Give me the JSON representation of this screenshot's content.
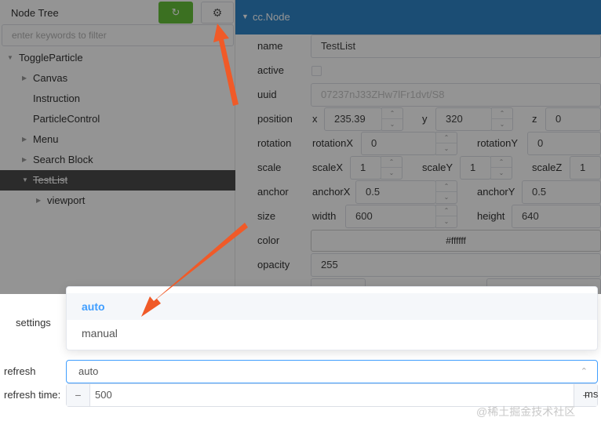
{
  "tree": {
    "title": "Node Tree",
    "refresh_icon": "refresh-icon",
    "settings_icon": "gear-icon",
    "filter_placeholder": "enter keywords to filter",
    "items": [
      {
        "label": "ToggleParticle"
      },
      {
        "label": "Canvas"
      },
      {
        "label": "Instruction"
      },
      {
        "label": "ParticleControl"
      },
      {
        "label": "Menu"
      },
      {
        "label": "Search Block"
      },
      {
        "label": "TestList"
      },
      {
        "label": "viewport"
      }
    ]
  },
  "inspector": {
    "component": "cc.Node",
    "name_label": "name",
    "name_value": "TestList",
    "active_label": "active",
    "uuid_label": "uuid",
    "uuid_value": "07237nJ33ZHw7lFr1dvt/S8",
    "position_label": "position",
    "pos_x_label": "x",
    "pos_x": "235.39",
    "pos_y_label": "y",
    "pos_y": "320",
    "pos_z_label": "z",
    "pos_z": "0",
    "rotation_label": "rotation",
    "rotx_label": "rotationX",
    "rotx": "0",
    "roty_label": "rotationY",
    "roty": "0",
    "scale_label": "scale",
    "scalex_label": "scaleX",
    "scalex": "1",
    "scaley_label": "scaleY",
    "scaley": "1",
    "scalez_label": "scaleZ",
    "scalez": "1",
    "anchor_label": "anchor",
    "anchorx_label": "anchorX",
    "anchorx": "0.5",
    "anchory_label": "anchorY",
    "anchory": "0.5",
    "size_label": "size",
    "width_label": "width",
    "width": "600",
    "height_label": "height",
    "height": "640",
    "color_label": "color",
    "color_value": "#ffffff",
    "opacity_label": "opacity",
    "opacity": "255"
  },
  "settings": {
    "title": "settings",
    "refresh_label": "refresh",
    "refresh_value": "auto",
    "options": [
      "auto",
      "manual"
    ],
    "refresh_time_label": "refresh time:",
    "refresh_time_value": "500",
    "minus": "−",
    "plus": "+",
    "unit": "ms"
  },
  "watermark": "@稀土掘金技术社区",
  "colors": {
    "accent": "#409eff",
    "header_blue": "#2f86c9",
    "refresh_green": "#67c23a",
    "arrow": "#f05a28"
  }
}
